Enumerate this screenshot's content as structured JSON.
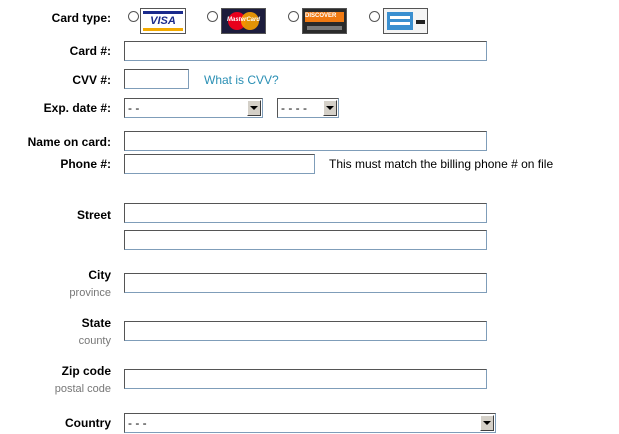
{
  "card_type": {
    "label": "Card type:",
    "options": [
      {
        "name": "VISA",
        "text": "VISA",
        "color": "#1a2a8c"
      },
      {
        "name": "MasterCard",
        "text": "MasterCard",
        "color": "#e8001c"
      },
      {
        "name": "Discover",
        "text": "DISCOVER",
        "color": "#f07a12"
      },
      {
        "name": "American Express",
        "text": "",
        "color": "#3a8fd0"
      }
    ]
  },
  "card_number": {
    "label": "Card #:",
    "value": ""
  },
  "cvv": {
    "label": "CVV #:",
    "value": "",
    "help_link": "What is CVV?"
  },
  "exp_date": {
    "label": "Exp. date #:",
    "month_value": "- -",
    "year_value": "- - - -"
  },
  "name_on_card": {
    "label": "Name on card:",
    "value": ""
  },
  "phone": {
    "label": "Phone #:",
    "value": "",
    "note": "This must match the billing phone # on file"
  },
  "street": {
    "label": "Street",
    "line1": "",
    "line2": ""
  },
  "city": {
    "label": "City",
    "sublabel": "province",
    "value": ""
  },
  "state": {
    "label": "State",
    "sublabel": "county",
    "value": ""
  },
  "zip": {
    "label": "Zip code",
    "sublabel": "postal code",
    "value": ""
  },
  "country": {
    "label": "Country",
    "value": "- - -"
  }
}
